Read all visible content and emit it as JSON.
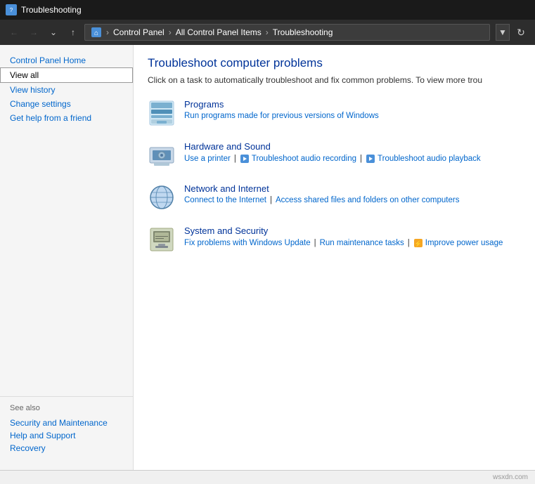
{
  "titleBar": {
    "icon": "T",
    "title": "Troubleshooting"
  },
  "addressBar": {
    "pathSegments": [
      "Control Panel",
      "All Control Panel Items",
      "Troubleshooting"
    ],
    "homeIcon": "⌂"
  },
  "sidebar": {
    "controlPanelHome": "Control Panel Home",
    "viewAll": "View all",
    "viewHistory": "View history",
    "changeSettings": "Change settings",
    "getHelp": "Get help from a friend",
    "seeAlso": "See also",
    "bottomLinks": [
      "Security and Maintenance",
      "Help and Support",
      "Recovery"
    ]
  },
  "content": {
    "title": "Troubleshoot computer problems",
    "description": "Click on a task to automatically troubleshoot and fix common problems. To view more trou",
    "categories": [
      {
        "name": "Programs",
        "links": [
          {
            "text": "Run programs made for previous versions of Windows",
            "hasIcon": false
          }
        ]
      },
      {
        "name": "Hardware and Sound",
        "links": [
          {
            "text": "Use a printer",
            "hasIcon": false
          },
          {
            "text": "Troubleshoot audio recording",
            "hasIcon": true,
            "iconColor": "#4a90d9"
          },
          {
            "text": "Troubleshoot audio playback",
            "hasIcon": true,
            "iconColor": "#4a90d9"
          }
        ]
      },
      {
        "name": "Network and Internet",
        "links": [
          {
            "text": "Connect to the Internet",
            "hasIcon": false
          },
          {
            "text": "Access shared files and folders on other computers",
            "hasIcon": false
          }
        ]
      },
      {
        "name": "System and Security",
        "links": [
          {
            "text": "Fix problems with Windows Update",
            "hasIcon": false
          },
          {
            "text": "Run maintenance tasks",
            "hasIcon": false
          },
          {
            "text": "Improve power usage",
            "hasIcon": true,
            "iconColor": "#f5a623"
          }
        ]
      }
    ]
  },
  "bottomBar": {
    "watermark": "wsxdn.com"
  }
}
